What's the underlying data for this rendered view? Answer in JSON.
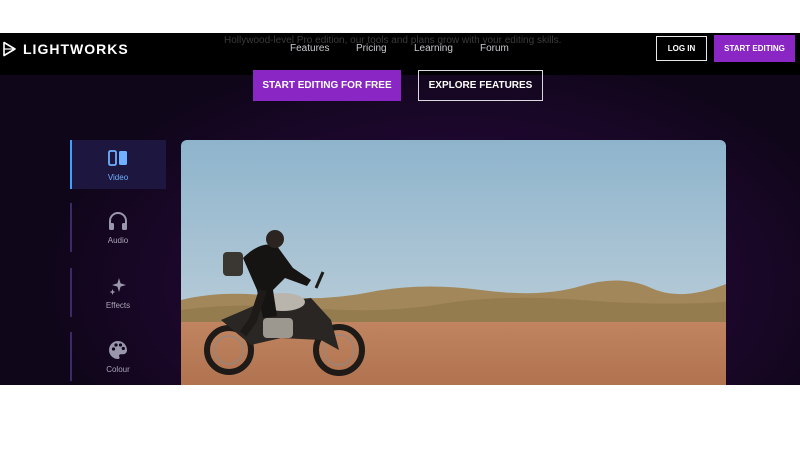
{
  "brand": {
    "name": "LIGHTWORKS"
  },
  "ghost_tagline": "Hollywood-level Pro edition, our tools and plans grow with your editing skills.",
  "nav": {
    "links": [
      "Features",
      "Pricing",
      "Learning",
      "Forum"
    ],
    "login_label": "LOG IN",
    "start_label": "START EDITING"
  },
  "hero": {
    "primary_cta": "START EDITING FOR FREE",
    "secondary_cta": "EXPLORE FEATURES"
  },
  "feature_tabs": [
    {
      "label": "Video",
      "icon": "video-icon",
      "active": true
    },
    {
      "label": "Audio",
      "icon": "headphones-icon",
      "active": false
    },
    {
      "label": "Effects",
      "icon": "sparkles-icon",
      "active": false
    },
    {
      "label": "Colour",
      "icon": "palette-icon",
      "active": false
    }
  ],
  "colors": {
    "accent": "#8a27c4",
    "active_tab": "#3fa0ff",
    "background": "#0f0619"
  }
}
